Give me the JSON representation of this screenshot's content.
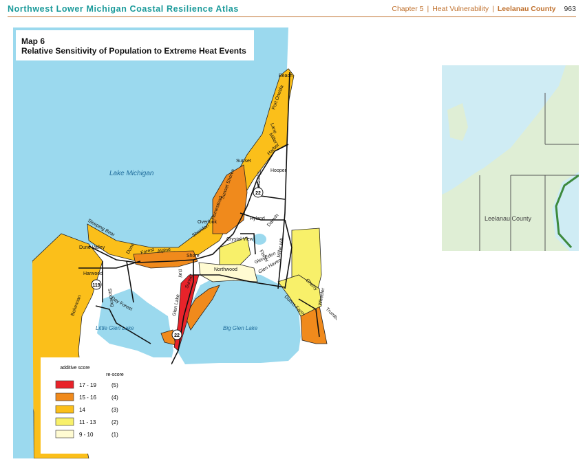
{
  "header": {
    "atlas_title": "Northwest Lower Michigan Coastal Resilience Atlas",
    "chapter": "Chapter 5",
    "section": "Heat Vulnerability",
    "county": "Leelanau County",
    "page_number": "963"
  },
  "map": {
    "number": "Map 6",
    "title": "Relative Sensitivity of Population to Extreme Heat Events",
    "water_labels": {
      "lake_michigan": "Lake Michigan",
      "little_glen_lake": "Little Glen Lake",
      "big_glen_lake": "Big Glen Lake"
    },
    "road_labels": [
      "Beach",
      "Port Oneida",
      "Lane",
      "Miller",
      "Harbor",
      "Sunset",
      "Hooper",
      "Thoreson",
      "Hyland",
      "Darwin",
      "Miller Hill",
      "Crystal View",
      "Fisher",
      "Glen Haven",
      "Overlook",
      "Homestead",
      "Sunset Shores",
      "Sleeping Bear",
      "Dune Valley",
      "Harwood",
      "Stocking",
      "Day Forest",
      "Bohemian",
      "Dune",
      "Northwood",
      "Glen Eden",
      "Cherry",
      "Wheeler",
      "Trumbull",
      "Dunns Farm",
      "Forest",
      "Alpine",
      "Shore",
      "Sheridan",
      "Ray",
      "Sunset",
      "Glen Lake"
    ],
    "route_markers": [
      "22",
      "119",
      "22"
    ],
    "colors": {
      "water": "#9bd9ee",
      "background_land": "#ffffff",
      "roads": "#111111"
    },
    "legend": {
      "col1_header": "additive score",
      "col2_header": "re-score",
      "items": [
        {
          "range": "17 - 19",
          "score": "(5)",
          "color": "#e8232a"
        },
        {
          "range": "15 - 16",
          "score": "(4)",
          "color": "#f08a1c"
        },
        {
          "range": "14",
          "score": "(3)",
          "color": "#fbbf1a"
        },
        {
          "range": "11 - 13",
          "score": "(2)",
          "color": "#f8f06a"
        },
        {
          "range": "9 - 10",
          "score": "(1)",
          "color": "#fffbd2"
        }
      ]
    }
  },
  "inset": {
    "label": "Leelanau County",
    "colors": {
      "water": "#cfecf4",
      "land": "#dfeed5",
      "boundary": "#555555",
      "shore": "#3d8a3d"
    }
  }
}
